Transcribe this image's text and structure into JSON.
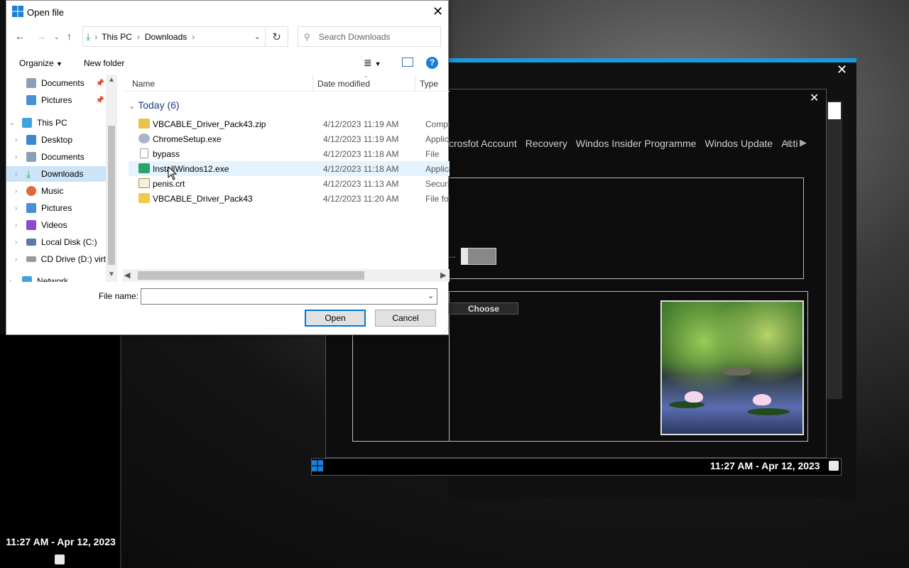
{
  "dialog": {
    "title": "Open file",
    "address": {
      "segments": [
        "This PC",
        "Downloads"
      ]
    },
    "search_placeholder": "Search Downloads",
    "toolbar": {
      "organize": "Organize",
      "new_folder": "New folder",
      "help": "?"
    },
    "nav_items": [
      {
        "label": "Documents",
        "icon": "documents-icon",
        "pinned": true
      },
      {
        "label": "Pictures",
        "icon": "pictures-icon",
        "pinned": true
      },
      {
        "label": "This PC",
        "icon": "this-pc-icon",
        "expanded": true
      },
      {
        "label": "Desktop",
        "icon": "desktop-icon"
      },
      {
        "label": "Documents",
        "icon": "documents-icon"
      },
      {
        "label": "Downloads",
        "icon": "downloads-icon",
        "selected": true
      },
      {
        "label": "Music",
        "icon": "music-icon"
      },
      {
        "label": "Pictures",
        "icon": "pictures-icon"
      },
      {
        "label": "Videos",
        "icon": "videos-icon"
      },
      {
        "label": "Local Disk (C:)",
        "icon": "drive-icon"
      },
      {
        "label": "CD Drive (D:) virt",
        "icon": "cd-drive-icon"
      },
      {
        "label": "Network",
        "icon": "network-icon"
      }
    ],
    "columns": {
      "name": "Name",
      "date": "Date modified",
      "type": "Type"
    },
    "group": "Today (6)",
    "files": [
      {
        "name": "VBCABLE_Driver_Pack43.zip",
        "date": "4/12/2023 11:19 AM",
        "type": "Compre",
        "icon": "zip-icon"
      },
      {
        "name": "ChromeSetup.exe",
        "date": "4/12/2023 11:19 AM",
        "type": "Applicat",
        "icon": "installer-icon"
      },
      {
        "name": "bypass",
        "date": "4/12/2023 11:18 AM",
        "type": "File",
        "icon": "file-icon"
      },
      {
        "name": "InstallWindos12.exe",
        "date": "4/12/2023 11:18 AM",
        "type": "Applicat",
        "icon": "app-icon"
      },
      {
        "name": "penis.crt",
        "date": "4/12/2023 11:13 AM",
        "type": "Security",
        "icon": "certificate-icon"
      },
      {
        "name": "VBCABLE_Driver_Pack43",
        "date": "4/12/2023 11:20 AM",
        "type": "File fold",
        "icon": "folder-icon"
      }
    ],
    "file_name_label": "File name:",
    "file_name_value": "",
    "open_label": "Open",
    "cancel_label": "Cancel"
  },
  "background_app": {
    "tabs": [
      "crosfot Account",
      "Recovery",
      "Windos Insider Programme",
      "Windos Update",
      "Acti"
    ],
    "ellipsis": "...",
    "choose_label": "Choose",
    "clock": "11:27 AM - Apr 12, 2023"
  },
  "desktop": {
    "clock": "11:27 AM - Apr 12, 2023"
  },
  "colors": {
    "accent": "#0078d7",
    "selection": "#cce4f7",
    "window_accent": "#1a9be0"
  }
}
